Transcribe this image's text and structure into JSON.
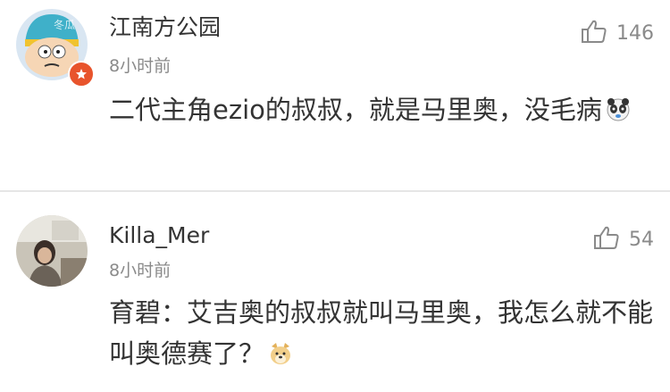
{
  "comments": [
    {
      "username": "江南方公园",
      "time": "8小时前",
      "text": "二代主角ezio的叔叔，就是马里奥，没毛病",
      "likes": "146",
      "emoji": "panda-face-emoji",
      "avatar": "cartoon-character-avatar",
      "badge": "verified-badge-icon"
    },
    {
      "username": "Killa_Mer",
      "time": "8小时前",
      "text": "育碧：艾吉奥的叔叔就叫马里奥，我怎么就不能叫奥德赛了？",
      "likes": "54",
      "emoji": "doge-emoji",
      "avatar": "photo-avatar"
    }
  ],
  "colors": {
    "username": "#333333",
    "time": "#8a8a8a",
    "text": "#333333",
    "divider": "#e6e6e6",
    "badge": "#e8542c"
  }
}
